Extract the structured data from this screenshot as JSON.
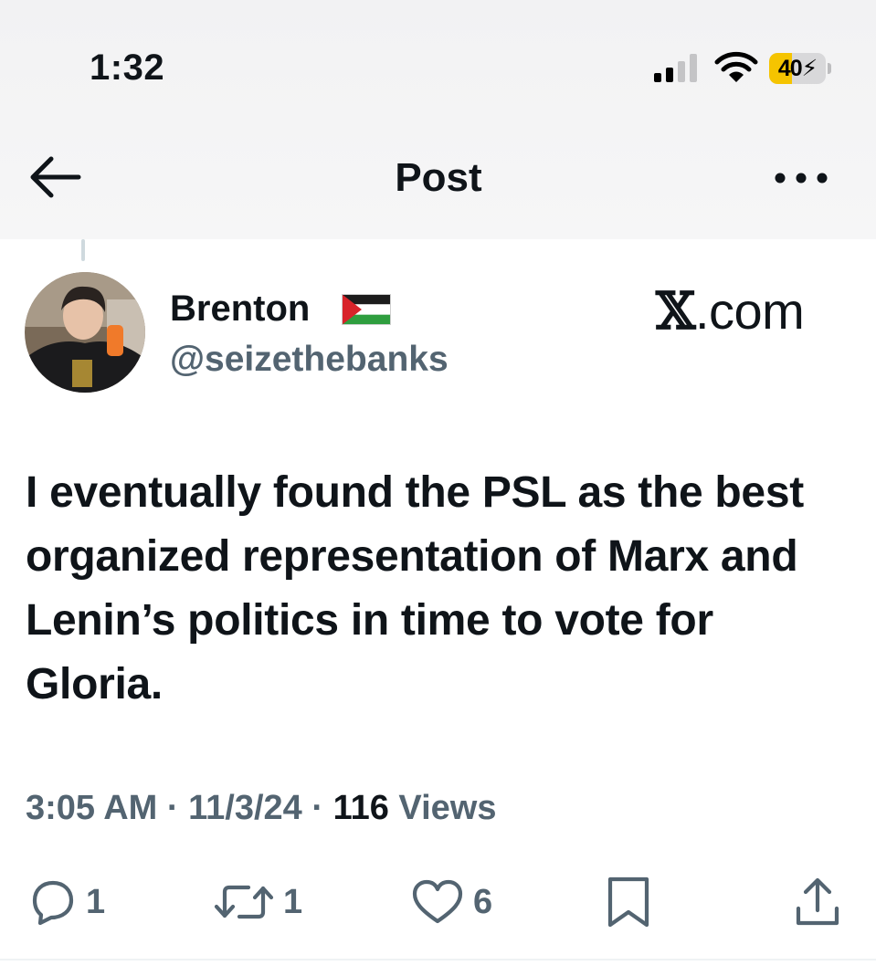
{
  "status_bar": {
    "time": "1:32",
    "battery_level": 40,
    "battery_label": "40",
    "signal_bars": 2,
    "icons": [
      "signal-icon",
      "wifi-icon",
      "battery-charging-icon"
    ]
  },
  "header": {
    "title": "Post",
    "back_icon": "arrow-left-icon",
    "more_icon": "more-horizontal-icon"
  },
  "post": {
    "author": {
      "display_name": "Brenton",
      "flag": "palestine-flag-emoji",
      "handle": "@seizethebanks"
    },
    "watermark": {
      "logo": "𝕏",
      "suffix": ".com"
    },
    "text": "I eventually found the PSL as the best organized representation of Marx and Lenin’s politics in time to vote for Gloria.",
    "meta": {
      "time": "3:05 AM",
      "separator": " · ",
      "date": "11/3/24",
      "views_count": "116",
      "views_label": " Views"
    },
    "actions": {
      "replies": "1",
      "reposts": "1",
      "likes": "6"
    }
  },
  "colors": {
    "text_primary": "#0f1419",
    "text_secondary": "#536471",
    "battery_fill": "#f5c400",
    "header_bg": "#f4f4f5"
  }
}
